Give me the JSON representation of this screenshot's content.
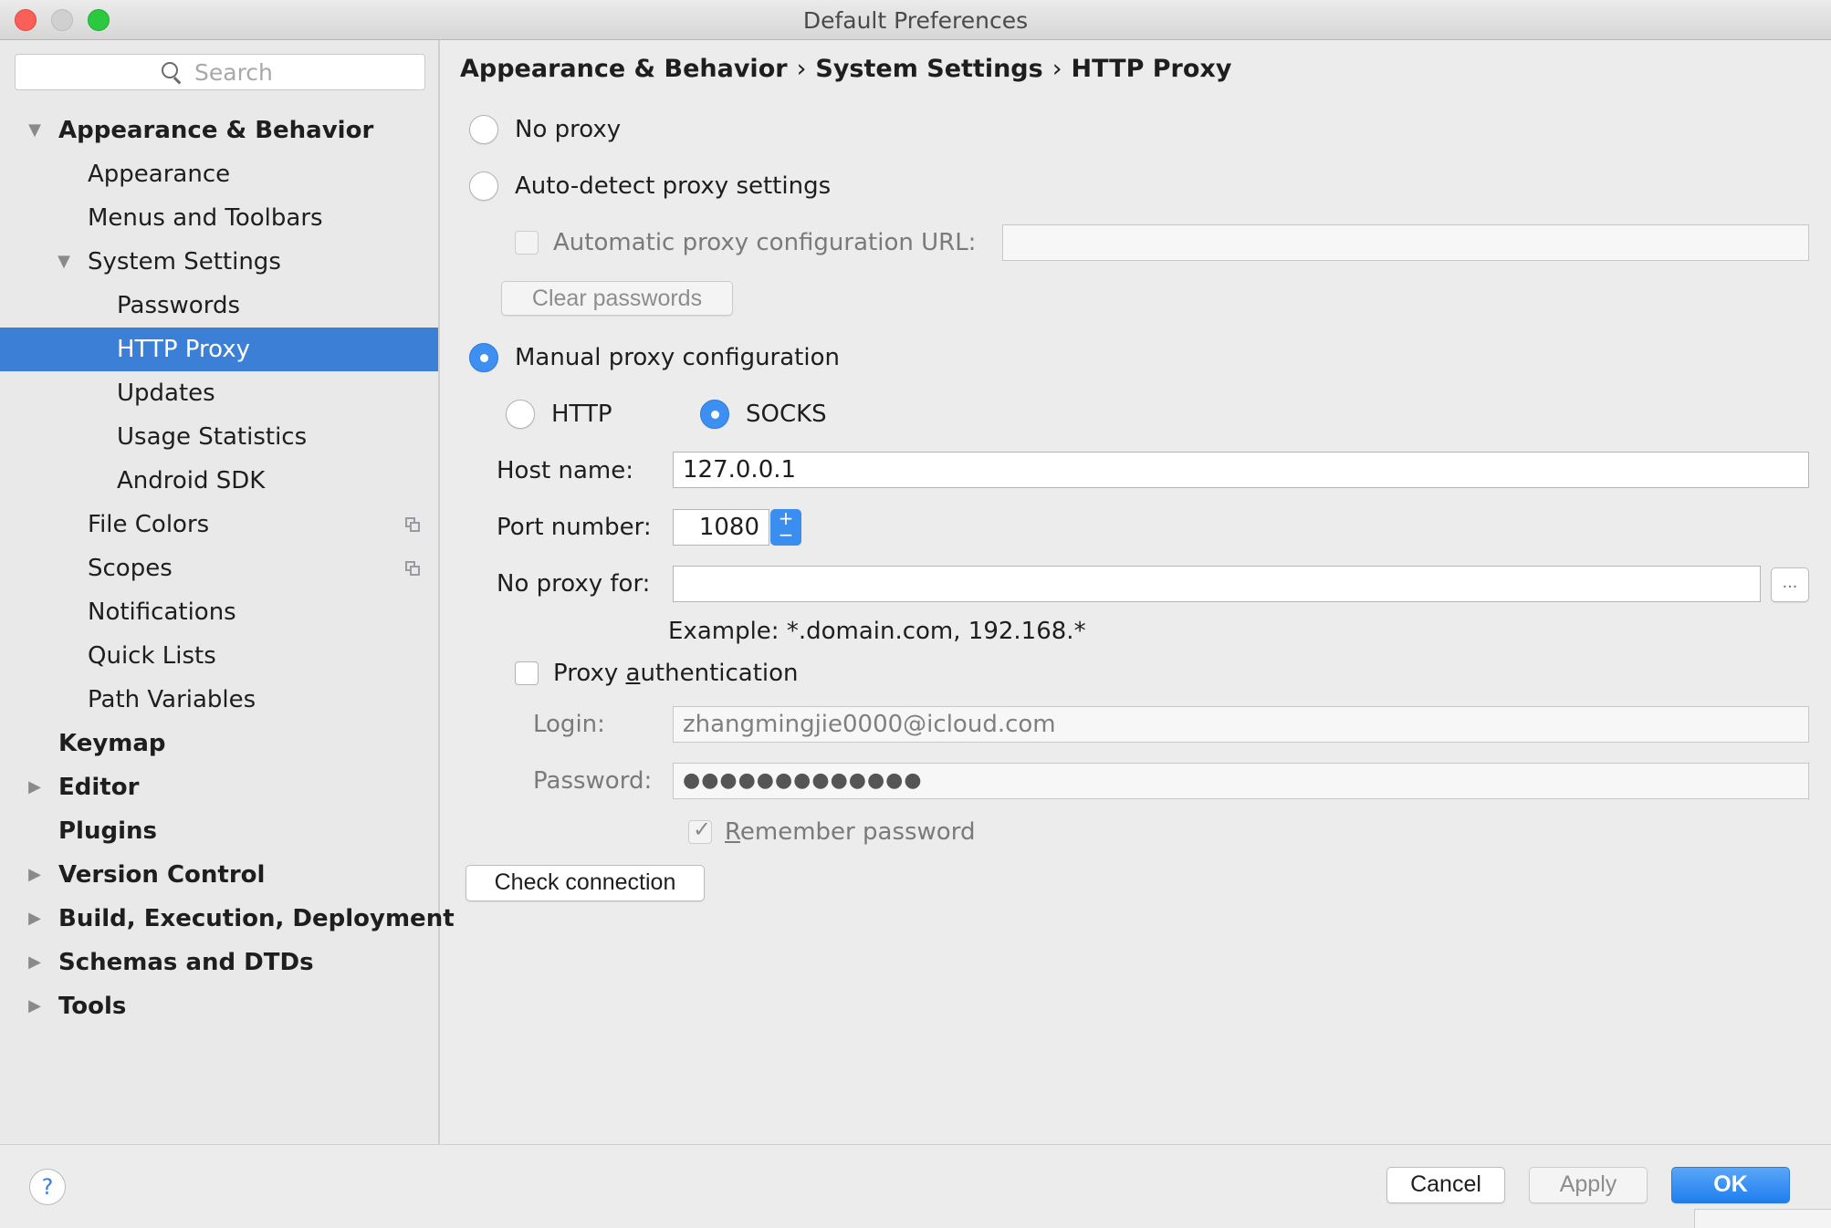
{
  "window": {
    "title": "Default Preferences"
  },
  "sidebar": {
    "search_placeholder": "Search",
    "items": [
      {
        "label": "Appearance & Behavior",
        "level": 0,
        "bold": true,
        "arrow": "expanded"
      },
      {
        "label": "Appearance",
        "level": 1
      },
      {
        "label": "Menus and Toolbars",
        "level": 1
      },
      {
        "label": "System Settings",
        "level": 1,
        "arrow": "expanded"
      },
      {
        "label": "Passwords",
        "level": 2
      },
      {
        "label": "HTTP Proxy",
        "level": 2,
        "selected": true
      },
      {
        "label": "Updates",
        "level": 2
      },
      {
        "label": "Usage Statistics",
        "level": 2
      },
      {
        "label": "Android SDK",
        "level": 2
      },
      {
        "label": "File Colors",
        "level": 1,
        "project_icon": true
      },
      {
        "label": "Scopes",
        "level": 1,
        "project_icon": true
      },
      {
        "label": "Notifications",
        "level": 1
      },
      {
        "label": "Quick Lists",
        "level": 1
      },
      {
        "label": "Path Variables",
        "level": 1
      },
      {
        "label": "Keymap",
        "level": 0,
        "bold": true
      },
      {
        "label": "Editor",
        "level": 0,
        "bold": true,
        "arrow": "collapsed"
      },
      {
        "label": "Plugins",
        "level": 0,
        "bold": true
      },
      {
        "label": "Version Control",
        "level": 0,
        "bold": true,
        "arrow": "collapsed"
      },
      {
        "label": "Build, Execution, Deployment",
        "level": 0,
        "bold": true,
        "arrow": "collapsed"
      },
      {
        "label": "Schemas and DTDs",
        "level": 0,
        "bold": true,
        "arrow": "collapsed"
      },
      {
        "label": "Tools",
        "level": 0,
        "bold": true,
        "arrow": "collapsed"
      }
    ]
  },
  "breadcrumb": {
    "items": [
      "Appearance & Behavior",
      "System Settings",
      "HTTP Proxy"
    ],
    "separator": "›"
  },
  "proxy": {
    "no_proxy_label": "No proxy",
    "auto_detect_label": "Auto-detect proxy settings",
    "auto_url_label": "Automatic proxy configuration URL:",
    "auto_url_value": "",
    "clear_passwords_label": "Clear passwords",
    "manual_label": "Manual proxy configuration",
    "selected_mode": "manual",
    "http_label": "HTTP",
    "socks_label": "SOCKS",
    "selected_type": "socks",
    "host_label": "Host name:",
    "host_value": "127.0.0.1",
    "port_label": "Port number:",
    "port_value": "1080",
    "no_proxy_for_label": "No proxy for:",
    "no_proxy_for_value": "",
    "browse_label": "...",
    "example_text": "Example: *.domain.com, 192.168.*",
    "auth_label_pre": "Proxy ",
    "auth_label_mnemonic": "a",
    "auth_label_post": "uthentication",
    "auth_checked": false,
    "login_label": "Login:",
    "login_value": "zhangmingjie0000@icloud.com",
    "password_label": "Password:",
    "password_value": "●●●●●●●●●●●●●",
    "remember_mnemonic": "R",
    "remember_label_rest": "emember password",
    "remember_checked": true,
    "check_connection_label": "Check connection"
  },
  "footer": {
    "help_label": "?",
    "cancel_label": "Cancel",
    "apply_label": "Apply",
    "ok_label": "OK"
  },
  "colors": {
    "selection": "#3b7fd6",
    "accent": "#3d8ff2",
    "close": "#fc5f57",
    "zoom": "#2ac940"
  }
}
